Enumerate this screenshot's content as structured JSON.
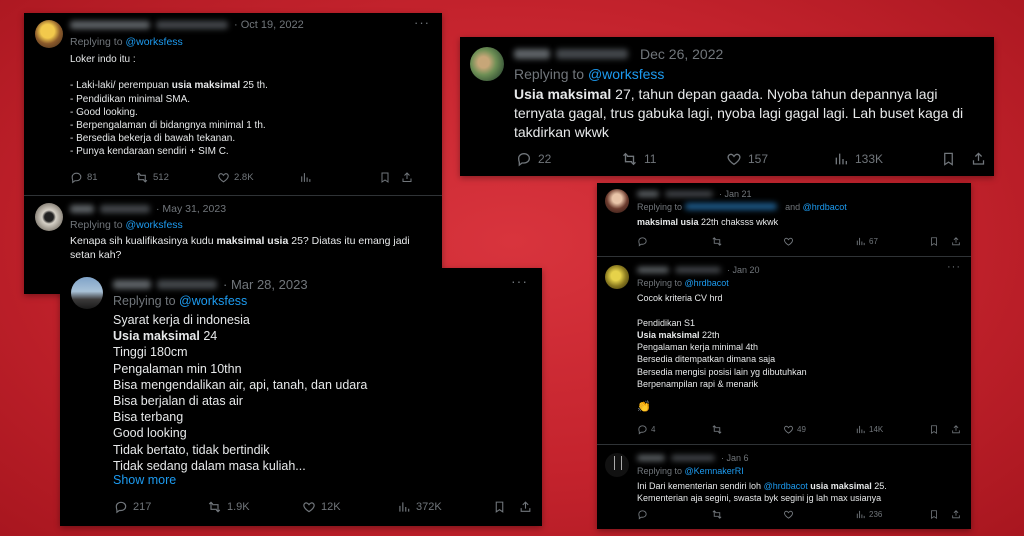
{
  "colors": {
    "background": "#c4232d",
    "card": "#000000",
    "text": "#e7e9ea",
    "muted": "#71767b",
    "link": "#1d9bf0"
  },
  "cards": {
    "a": {
      "t1": {
        "date": "· Oct 19, 2022",
        "replying": "Replying to",
        "mention": "@worksfess",
        "body_pre": "Loker indo itu :\n\n- Laki-laki/ perempuan ",
        "body_bold": "usia maksimal",
        "body_post": " 25 th.\n- Pendidikan minimal SMA.\n- Good looking.\n- Berpengalaman di bidangnya minimal 1 th.\n- Bersedia bekerja di bawah tekanan.\n- Punya kendaraan sendiri + SIM C.",
        "replies": "81",
        "retweets": "512",
        "likes": "2.8K"
      },
      "t2": {
        "date": "· May 31, 2023",
        "replying": "Replying to",
        "mention": "@worksfess",
        "body_pre": "Kenapa sih kualifikasinya kudu ",
        "body_bold": "maksimal usia",
        "body_post": " 25? Diatas itu emang jadi setan kah?"
      }
    },
    "b": {
      "date": "Dec 26, 2022",
      "replying": "Replying to",
      "mention": "@worksfess",
      "body_bold": "Usia maksimal",
      "body_post": " 27, tahun depan gaada. Nyoba tahun depannya lagi ternyata gagal, trus gabuka lagi, nyoba lagi gagal lagi. Lah buset kaga di takdirkan wkwk",
      "replies": "22",
      "retweets": "11",
      "likes": "157",
      "views": "133K"
    },
    "c": {
      "date": "· Mar 28, 2023",
      "replying": "Replying to",
      "mention": "@worksfess",
      "line1": "Syarat kerja di indonesia",
      "line2_bold": "Usia maksimal",
      "line2_post": " 24",
      "lines_rest": "Tinggi 180cm\nPengalaman min 10thn\nBisa mengendalikan air, api, tanah, dan udara\nBisa berjalan di atas air\nBisa terbang\nGood looking\nTidak bertato, tidak bertindik\nTidak sedang dalam masa kuliah...",
      "show_more": "Show more",
      "replies": "217",
      "retweets": "1.9K",
      "likes": "12K",
      "views": "372K"
    },
    "d": {
      "t1": {
        "date": "· Jan 21",
        "replying": "Replying to",
        "mention_and": "and",
        "mention": "@hrdbacot",
        "body_bold": "maksimal usia",
        "body_post": " 22th chaksss wkwk",
        "views": "67"
      },
      "t2": {
        "date": "· Jan 20",
        "replying": "Replying to",
        "mention": "@hrdbacot",
        "line1": "Cocok kriteria CV hrd",
        "line2": "Pendidikan S1",
        "line3_bold": "Usia maksimal",
        "line3_post": " 22th",
        "lines_rest": "Pengalaman kerja minimal 4th\nBersedia ditempatkan dimana saja\nBersedia mengisi posisi lain yg dibutuhkan\nBerpenampilan rapi & menarik",
        "emoji": "👏",
        "replies": "4",
        "likes": "49",
        "views": "14K"
      },
      "t3": {
        "date": "· Jan 6",
        "replying": "Replying to",
        "mention": "@KemnakerRI",
        "body_pre": "Ini Dari kementerian sendiri loh ",
        "body_mention": "@hrdbacot",
        "body_bold": " usia maksimal",
        "body_post": " 25.\nKementerian aja segini, swasta byk segini jg lah max usianya",
        "views": "236"
      }
    }
  }
}
